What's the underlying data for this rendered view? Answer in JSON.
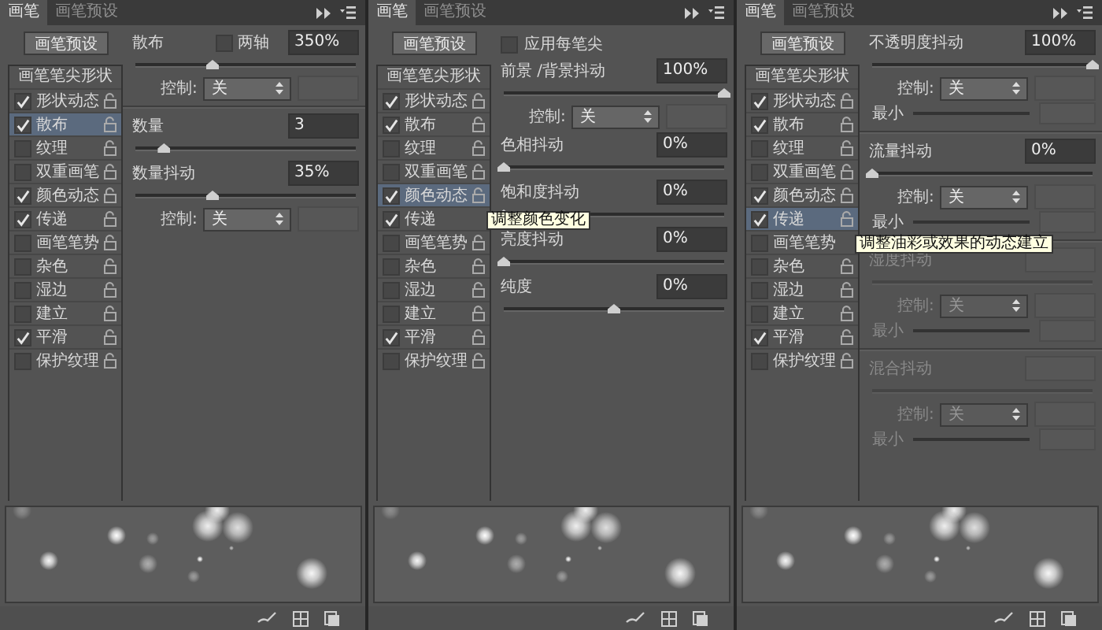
{
  "panels": [
    {
      "tabs": [
        {
          "label": "画笔",
          "selected": true
        },
        {
          "label": "画笔预设",
          "selected": false
        }
      ],
      "preset_button": "画笔预设",
      "list_header": "画笔笔尖形状",
      "items": [
        {
          "label": "形状动态",
          "checked": true,
          "selected": false,
          "lock": true
        },
        {
          "label": "散布",
          "checked": true,
          "selected": true,
          "lock": true
        },
        {
          "label": "纹理",
          "checked": false,
          "selected": false,
          "lock": true
        },
        {
          "label": "双重画笔",
          "checked": false,
          "selected": false,
          "lock": true
        },
        {
          "label": "颜色动态",
          "checked": true,
          "selected": false,
          "lock": true
        },
        {
          "label": "传递",
          "checked": true,
          "selected": false,
          "lock": true
        },
        {
          "label": "画笔笔势",
          "checked": false,
          "selected": false,
          "lock": true
        },
        {
          "label": "杂色",
          "checked": false,
          "selected": false,
          "lock": true
        },
        {
          "label": "湿边",
          "checked": false,
          "selected": false,
          "lock": true
        },
        {
          "label": "建立",
          "checked": false,
          "selected": false,
          "lock": true
        },
        {
          "label": "平滑",
          "checked": true,
          "selected": false,
          "lock": true
        },
        {
          "label": "保护纹理",
          "checked": false,
          "selected": false,
          "lock": true
        }
      ],
      "settings": [
        {
          "kind": "value",
          "label": "散布",
          "value": "350%",
          "option": {
            "label": "两轴",
            "checked": false
          },
          "disabled": false
        },
        {
          "kind": "slider",
          "level": 0.35,
          "disabled": false
        },
        {
          "kind": "control",
          "label": "控制:",
          "value": "关",
          "disabled": false
        },
        {
          "kind": "rule"
        },
        {
          "kind": "value",
          "label": "数量",
          "value": "3",
          "disabled": false
        },
        {
          "kind": "slider",
          "level": 0.13,
          "disabled": false
        },
        {
          "kind": "value",
          "label": "数量抖动",
          "value": "35%",
          "disabled": false
        },
        {
          "kind": "slider",
          "level": 0.35,
          "disabled": false
        },
        {
          "kind": "control",
          "label": "控制:",
          "value": "关",
          "disabled": false
        }
      ]
    },
    {
      "tabs": [
        {
          "label": "画笔",
          "selected": true
        },
        {
          "label": "画笔预设",
          "selected": false
        }
      ],
      "preset_button": "画笔预设",
      "list_header": "画笔笔尖形状",
      "items": [
        {
          "label": "形状动态",
          "checked": true,
          "selected": false,
          "lock": true
        },
        {
          "label": "散布",
          "checked": true,
          "selected": false,
          "lock": true
        },
        {
          "label": "纹理",
          "checked": false,
          "selected": false,
          "lock": true
        },
        {
          "label": "双重画笔",
          "checked": false,
          "selected": false,
          "lock": true
        },
        {
          "label": "颜色动态",
          "checked": true,
          "selected": true,
          "lock": true
        },
        {
          "label": "传递",
          "checked": true,
          "selected": false,
          "lock": false,
          "tooltip": "调整颜色变化"
        },
        {
          "label": "画笔笔势",
          "checked": false,
          "selected": false,
          "lock": true
        },
        {
          "label": "杂色",
          "checked": false,
          "selected": false,
          "lock": true
        },
        {
          "label": "湿边",
          "checked": false,
          "selected": false,
          "lock": true
        },
        {
          "label": "建立",
          "checked": false,
          "selected": false,
          "lock": true
        },
        {
          "label": "平滑",
          "checked": true,
          "selected": false,
          "lock": true
        },
        {
          "label": "保护纹理",
          "checked": false,
          "selected": false,
          "lock": true
        }
      ],
      "settings": [
        {
          "kind": "check",
          "label": "应用每笔尖",
          "checked": false,
          "disabled": false
        },
        {
          "kind": "value",
          "label": "前景 /背景抖动",
          "value": "100%",
          "disabled": false
        },
        {
          "kind": "slider",
          "level": 1,
          "disabled": false
        },
        {
          "kind": "control",
          "label": "控制:",
          "value": "关",
          "disabled": false
        },
        {
          "kind": "value",
          "label": "色相抖动",
          "value": "0%",
          "disabled": false
        },
        {
          "kind": "slider",
          "level": 0,
          "disabled": false
        },
        {
          "kind": "value",
          "label": "饱和度抖动",
          "value": "0%",
          "disabled": false
        },
        {
          "kind": "slider",
          "level": 0,
          "disabled": false
        },
        {
          "kind": "value",
          "label": "亮度抖动",
          "value": "0%",
          "disabled": false
        },
        {
          "kind": "slider",
          "level": 0,
          "disabled": false
        },
        {
          "kind": "value",
          "label": "纯度",
          "value": "0%",
          "disabled": false
        },
        {
          "kind": "slider",
          "level": 0.5,
          "disabled": false
        }
      ]
    },
    {
      "tabs": [
        {
          "label": "画笔",
          "selected": true
        },
        {
          "label": "画笔预设",
          "selected": false
        }
      ],
      "preset_button": "画笔预设",
      "list_header": "画笔笔尖形状",
      "items": [
        {
          "label": "形状动态",
          "checked": true,
          "selected": false,
          "lock": true
        },
        {
          "label": "散布",
          "checked": true,
          "selected": false,
          "lock": true
        },
        {
          "label": "纹理",
          "checked": false,
          "selected": false,
          "lock": true
        },
        {
          "label": "双重画笔",
          "checked": false,
          "selected": false,
          "lock": true
        },
        {
          "label": "颜色动态",
          "checked": true,
          "selected": false,
          "lock": true
        },
        {
          "label": "传递",
          "checked": true,
          "selected": true,
          "lock": true
        },
        {
          "label": "画笔笔势",
          "checked": false,
          "selected": false,
          "lock": false,
          "tooltip": "调整油彩或效果的动态建立"
        },
        {
          "label": "杂色",
          "checked": false,
          "selected": false,
          "lock": true
        },
        {
          "label": "湿边",
          "checked": false,
          "selected": false,
          "lock": true
        },
        {
          "label": "建立",
          "checked": false,
          "selected": false,
          "lock": true
        },
        {
          "label": "平滑",
          "checked": true,
          "selected": false,
          "lock": true
        },
        {
          "label": "保护纹理",
          "checked": false,
          "selected": false,
          "lock": true
        }
      ],
      "settings": [
        {
          "kind": "value",
          "label": "不透明度抖动",
          "value": "100%",
          "disabled": false
        },
        {
          "kind": "slider",
          "level": 1,
          "disabled": false
        },
        {
          "kind": "control",
          "label": "控制:",
          "value": "关",
          "disabled": false
        },
        {
          "kind": "min",
          "label": "最小",
          "disabled": false
        },
        {
          "kind": "rule"
        },
        {
          "kind": "value",
          "label": "流量抖动",
          "value": "0%",
          "disabled": false
        },
        {
          "kind": "slider",
          "level": 0,
          "disabled": false
        },
        {
          "kind": "control",
          "label": "控制:",
          "value": "关",
          "disabled": false
        },
        {
          "kind": "min",
          "label": "最小",
          "disabled": false
        },
        {
          "kind": "rule"
        },
        {
          "kind": "value",
          "label": "湿度抖动",
          "disabled": true
        },
        {
          "kind": "slider",
          "disabled": true
        },
        {
          "kind": "control",
          "label": "控制:",
          "value": "关",
          "disabled": true
        },
        {
          "kind": "min",
          "label": "最小",
          "disabled": true
        },
        {
          "kind": "rule"
        },
        {
          "kind": "value",
          "label": "混合抖动",
          "disabled": true
        },
        {
          "kind": "slider",
          "disabled": true
        },
        {
          "kind": "control",
          "label": "控制:",
          "value": "关",
          "disabled": true
        },
        {
          "kind": "min",
          "label": "最小",
          "disabled": true
        }
      ]
    }
  ]
}
